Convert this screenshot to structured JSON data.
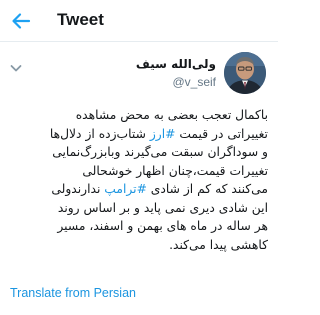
{
  "header": {
    "title": "Tweet",
    "back_icon": "arrow-left-icon",
    "accent_color": "#1da1f2"
  },
  "author": {
    "display_name": "ولی‌الله سیف",
    "handle": "@v_seif",
    "menu_icon": "chevron-down-icon"
  },
  "tweet": {
    "lines": [
      [
        {
          "text": "باکمال تعجب بعضی به محض مشاهده"
        }
      ],
      [
        {
          "text": "تغییراتی در قیمت "
        },
        {
          "text": "#ارز",
          "hashtag": true
        },
        {
          "text": " شتاب‌زده از دلال‌ها"
        }
      ],
      [
        {
          "text": "و سوداگران سبقت می‌گیرند وبابزرگ‌نمایی"
        }
      ],
      [
        {
          "text": "تغییرات قیمت،چنان اظهار خوشحالی"
        }
      ],
      [
        {
          "text": "می‌کنند که کم از شادی "
        },
        {
          "text": "#ترامپ",
          "hashtag": true
        },
        {
          "text": " ندارند‌ولی"
        }
      ],
      [
        {
          "text": "این شادی دیری نمی پاید و بر اساس روند"
        }
      ],
      [
        {
          "text": "هر ساله در ماه های بهمن و اسفند، مسیر"
        }
      ],
      [
        {
          "text": "کاهشی پیدا می‌کند."
        }
      ]
    ],
    "hashtag_color": "#1b95e0"
  },
  "footer": {
    "translate_label": "Translate from Persian"
  }
}
